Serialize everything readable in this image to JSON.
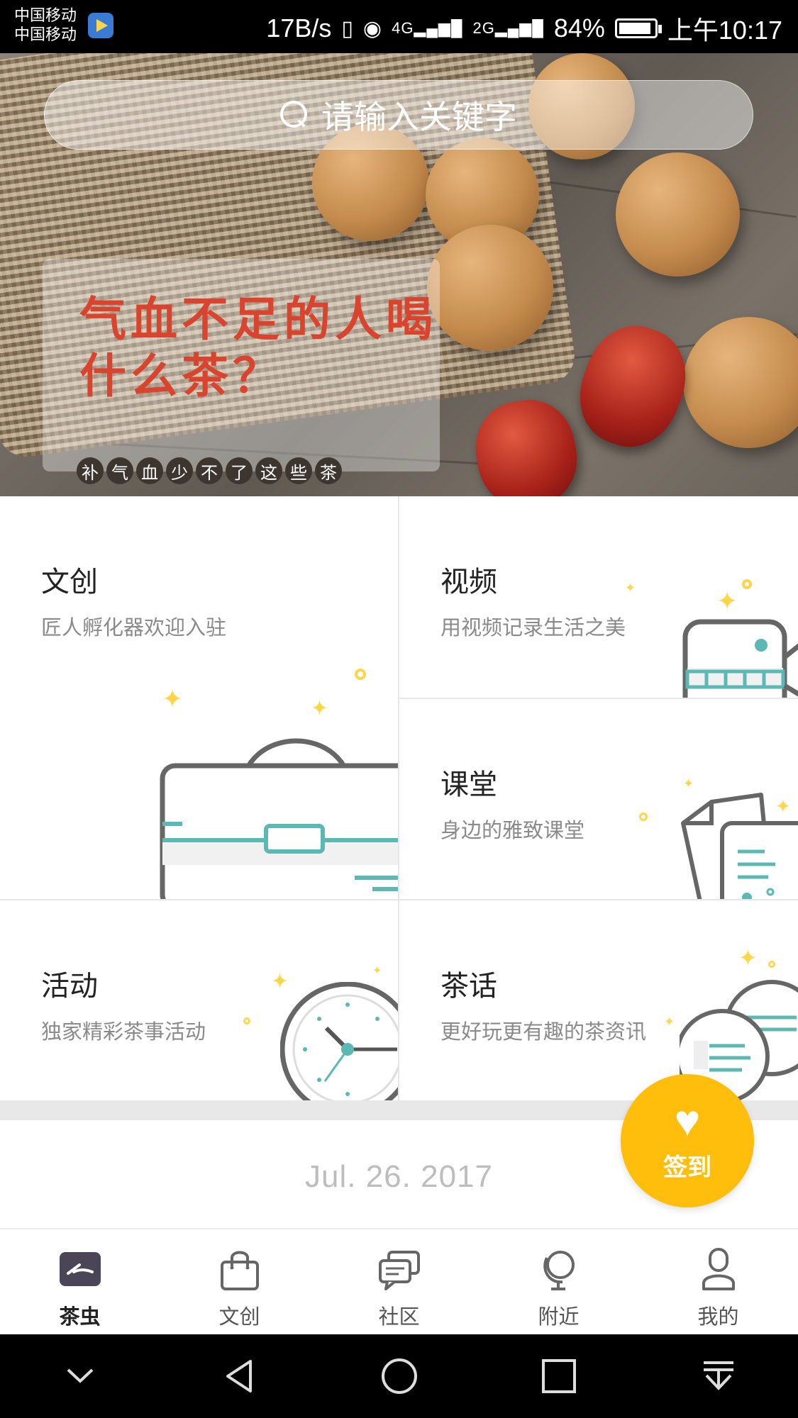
{
  "status_bar": {
    "carrier_1": "中国移动",
    "carrier_2": "中国移动",
    "net_speed": "17B/s",
    "signal_4g": "4G",
    "signal_2g": "2G",
    "battery": "84%",
    "time": "上午10:17"
  },
  "search": {
    "placeholder": "请输入关键字"
  },
  "banner": {
    "title": "气血不足的人喝什么茶？",
    "tags": [
      "补",
      "气",
      "血",
      "少",
      "不",
      "了",
      "这",
      "些",
      "茶"
    ],
    "page_count": 3,
    "active_page": 3
  },
  "grid": {
    "wenchuang": {
      "title": "文创",
      "subtitle": "匠人孵化器欢迎入驻"
    },
    "video": {
      "title": "视频",
      "subtitle": "用视频记录生活之美"
    },
    "classroom": {
      "title": "课堂",
      "subtitle": "身边的雅致课堂"
    },
    "activity": {
      "title": "活动",
      "subtitle": "独家精彩茶事活动"
    },
    "tea_talk": {
      "title": "茶话",
      "subtitle": "更好玩更有趣的茶资讯"
    }
  },
  "date": "Jul. 26. 2017",
  "checkin": {
    "label": "签到",
    "icon": "heart-icon",
    "color": "#ffbe0b"
  },
  "tabs": [
    {
      "label": "茶虫",
      "icon": "chachong-logo-icon",
      "active": true
    },
    {
      "label": "文创",
      "icon": "shopping-bag-icon",
      "active": false
    },
    {
      "label": "社区",
      "icon": "chat-bubbles-icon",
      "active": false
    },
    {
      "label": "附近",
      "icon": "globe-icon",
      "active": false
    },
    {
      "label": "我的",
      "icon": "person-icon",
      "active": false
    }
  ],
  "colors": {
    "accent": "#ffbe0b",
    "teal": "#5cb8b2",
    "promo_red": "#d9442e"
  }
}
